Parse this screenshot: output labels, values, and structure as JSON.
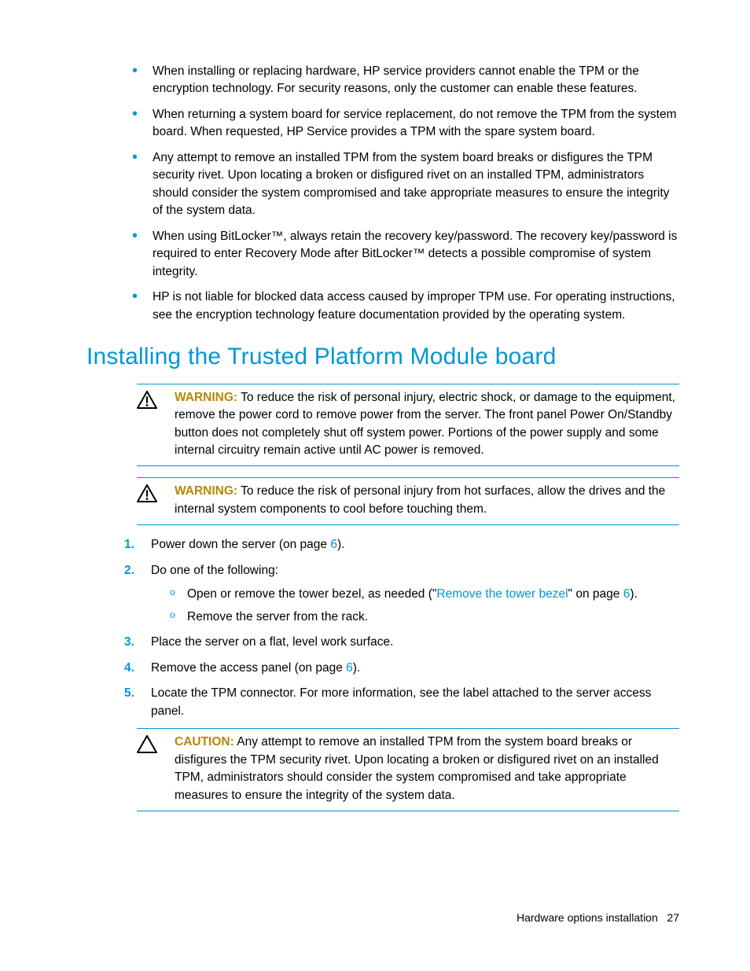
{
  "top_bullets": [
    "When installing or replacing hardware, HP service providers cannot enable the TPM or the encryption technology. For security reasons, only the customer can enable these features.",
    "When returning a system board for service replacement, do not remove the TPM from the system board. When requested, HP Service provides a TPM with the spare system board.",
    "Any attempt to remove an installed TPM from the system board breaks or disfigures the TPM security rivet. Upon locating a broken or disfigured rivet on an installed TPM, administrators should consider the system compromised and take appropriate measures to ensure the integrity of the system data.",
    "When using BitLocker™, always retain the recovery key/password. The recovery key/password is required to enter Recovery Mode after BitLocker™ detects a possible compromise of system integrity.",
    "HP is not liable for blocked data access caused by improper TPM use. For operating instructions, see the encryption technology feature documentation provided by the operating system."
  ],
  "heading": "Installing the Trusted Platform Module board",
  "warning1": {
    "label": "WARNING:",
    "text": "  To reduce the risk of personal injury, electric shock, or damage to the equipment, remove the power cord to remove power from the server. The front panel Power On/Standby button does not completely shut off system power. Portions of the power supply and some internal circuitry remain active until AC power is removed."
  },
  "warning2": {
    "label": "WARNING:",
    "text": "  To reduce the risk of personal injury from hot surfaces, allow the drives and the internal system components to cool before touching them."
  },
  "steps": {
    "s1_pre": "Power down the server (on page ",
    "s1_link": "6",
    "s1_post": ").",
    "s2": "Do one of the following:",
    "s2a_pre": "Open or remove the tower bezel, as needed (\"",
    "s2a_link": "Remove the tower bezel",
    "s2a_mid": "\" on page ",
    "s2a_page": "6",
    "s2a_post": ").",
    "s2b": "Remove the server from the rack.",
    "s3": "Place the server on a flat, level work surface.",
    "s4_pre": "Remove the access panel (on page ",
    "s4_link": "6",
    "s4_post": ").",
    "s5": "Locate the TPM connector. For more information, see the label attached to the server access panel."
  },
  "caution": {
    "label": "CAUTION:",
    "text": "  Any attempt to remove an installed TPM from the system board breaks or disfigures the TPM security rivet. Upon locating a broken or disfigured rivet on an installed TPM, administrators should consider the system compromised and take appropriate measures to ensure the integrity of the system data."
  },
  "footer": {
    "section": "Hardware options installation",
    "page": "27"
  }
}
